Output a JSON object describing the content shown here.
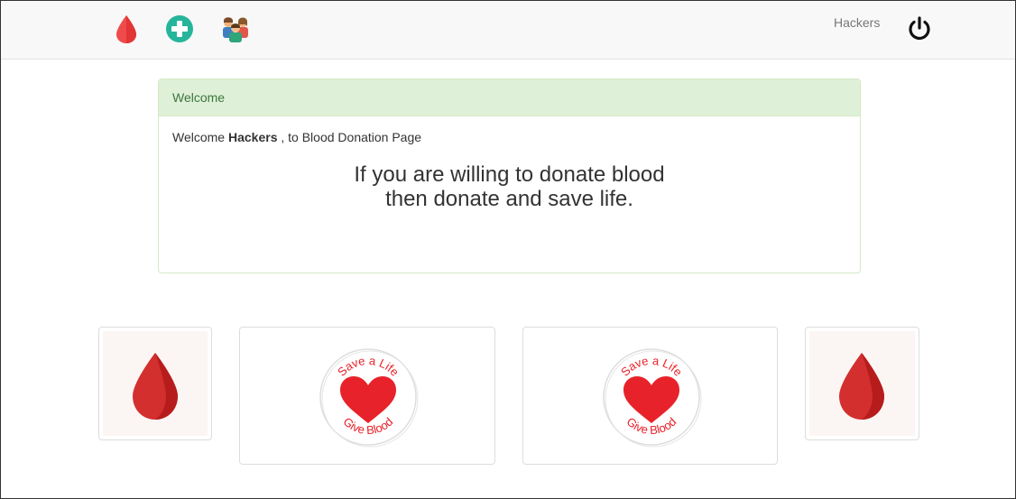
{
  "navbar": {
    "icons": [
      {
        "name": "blood-drop-icon"
      },
      {
        "name": "add-icon"
      },
      {
        "name": "users-icon"
      }
    ],
    "username": "Hackers",
    "logout_icon": "power-icon"
  },
  "panel": {
    "heading": "Welcome",
    "greeting_prefix": "Welcome",
    "greeting_name": "Hackers",
    "greeting_suffix": ", to Blood Donation Page",
    "tagline_line1": "If you are willing to donate blood",
    "tagline_line2": "then donate and save life."
  },
  "badges": {
    "top_text": "Save a Life",
    "bottom_text": "Give Blood"
  },
  "colors": {
    "panel_heading_bg": "#dff0d8",
    "panel_heading_text": "#3c763d",
    "blood_red": "#d32f2f",
    "heart_red": "#e8222a",
    "add_teal": "#26b59a"
  }
}
